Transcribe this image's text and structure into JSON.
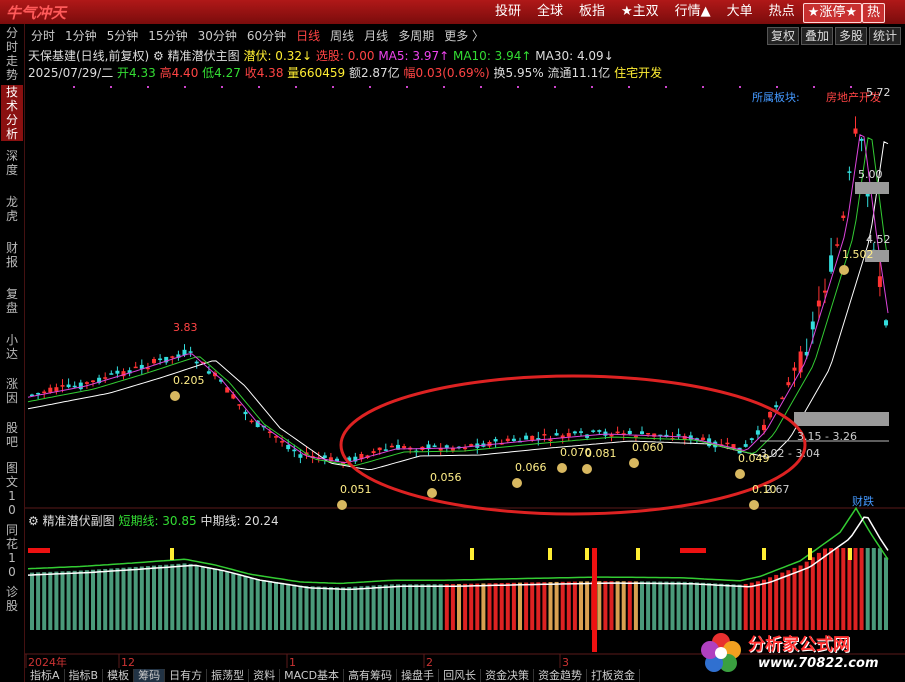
{
  "app": {
    "logo": "牛气冲天",
    "top_nav": [
      "投研",
      "全球",
      "板指",
      "★主双",
      "行情▲",
      "大单",
      "热点"
    ],
    "top_pill": "★涨停★",
    "top_pill_extra": "热"
  },
  "sidebar": {
    "items": [
      {
        "label": "分时走势",
        "active": false
      },
      {
        "label": "技术分析",
        "active": true
      },
      {
        "label": "深度",
        "active": false
      },
      {
        "label": "龙虎",
        "active": false
      },
      {
        "label": "财报",
        "active": false
      },
      {
        "label": "复盘",
        "active": false
      },
      {
        "label": "小达",
        "active": false
      },
      {
        "label": "涨因",
        "active": false
      },
      {
        "label": "股吧",
        "active": false
      },
      {
        "label": "图文10",
        "active": false
      },
      {
        "label": "同花10",
        "active": false
      },
      {
        "label": "诊股",
        "active": false
      }
    ]
  },
  "period_tabs": [
    "分时",
    "1分钟",
    "5分钟",
    "15分钟",
    "30分钟",
    "60分钟",
    "日线",
    "周线",
    "月线",
    "多周期",
    "更多 〉"
  ],
  "active_tab": "日线",
  "right_tools": [
    "复权",
    "叠加",
    "多股",
    "统计"
  ],
  "quote": {
    "stock": "天保基建(日线,前复权)",
    "indicator": "精准潜伏主图",
    "latent": "潜伏: 0.32↓",
    "pick": "选股: 0.00",
    "ma5": "MA5: 3.97↑",
    "ma10": "MA10: 3.94↑",
    "ma30": "MA30: 4.09↓",
    "date": "2025/07/29/二",
    "open": "开4.33",
    "high": "高4.40",
    "low": "低4.27",
    "close": "收4.38",
    "volume": "量660459",
    "amount": "额2.87亿",
    "change": "幅0.03(0.69%)",
    "turnover": "换5.95%",
    "float": "流通11.1亿",
    "sector": "住宅开发"
  },
  "chart_labels": {
    "sector_label": "所属板块:",
    "sector_value": "房地产开发",
    "price_high": "5.72",
    "price_5": "5.00",
    "price_452": "4.52",
    "peak_left": "3.83",
    "range1": "3.15 - 3.26",
    "range2": "3.02 - 3.04",
    "low_mark": "2.67",
    "tag_buy": "财跌"
  },
  "sub_chart": {
    "title": "精准潜伏副图",
    "short_line": "短期线: 30.85",
    "mid_line": "中期线: 20.24"
  },
  "time_axis": [
    "2024年",
    "12",
    "1",
    "2",
    "3"
  ],
  "bottom_tabs": [
    "指标A",
    "指标B",
    "模板",
    "筹码",
    "日有方",
    "振荡型",
    "资料",
    "MACD基本",
    "高有筹码",
    "操盘手",
    "回风长",
    "资金决策",
    "资金趋势",
    "打板资金"
  ],
  "watermark": {
    "brand": "分析家公式网",
    "url": "www.70822.com"
  },
  "chart_data": {
    "type": "candlestick",
    "annotations": [
      {
        "label": "0.205"
      },
      {
        "label": "0.051"
      },
      {
        "label": "0.056"
      },
      {
        "label": "0.066"
      },
      {
        "label": "0.070"
      },
      {
        "label": "0.081"
      },
      {
        "label": "0.060"
      },
      {
        "label": "0.049"
      },
      {
        "label": "0.10"
      },
      {
        "label": "1.502"
      }
    ],
    "colors": {
      "up": "#ff3333",
      "down": "#33dddd",
      "ma_white": "#ffffff",
      "ma_green": "#33cc33",
      "ma_magenta": "#dd44dd",
      "ellipse": "#dd2222"
    }
  }
}
